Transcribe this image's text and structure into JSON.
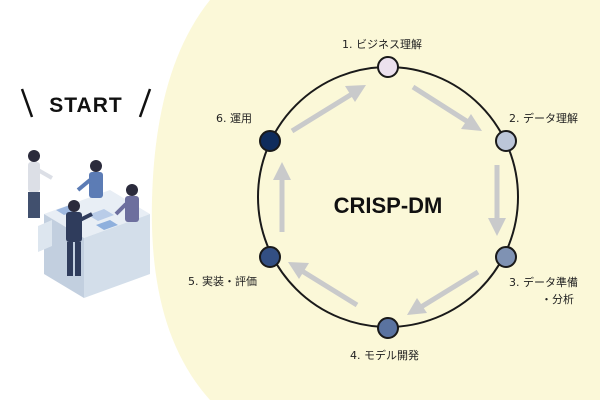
{
  "start": {
    "text": "START"
  },
  "cycle": {
    "title": "CRISP-DM",
    "steps": [
      {
        "label": "1. ビジネス理解",
        "color": "#ece1ee"
      },
      {
        "label": "2. データ理解",
        "color": "#bcc6d9"
      },
      {
        "label": "3. データ準備",
        "label_line2": "・分析",
        "color": "#7f92b3"
      },
      {
        "label": "4. モデル開発",
        "color": "#5a73a0"
      },
      {
        "label": "5. 実装・評価",
        "color": "#334f83"
      },
      {
        "label": "6. 運用",
        "color": "#0f2c5c"
      }
    ]
  },
  "colors": {
    "background_blob": "#fbf8d8",
    "ring": "#1a1a1a",
    "arrow": "#c9cacb"
  },
  "illustration": {
    "description_icon": "business-team-meeting-illustration"
  }
}
